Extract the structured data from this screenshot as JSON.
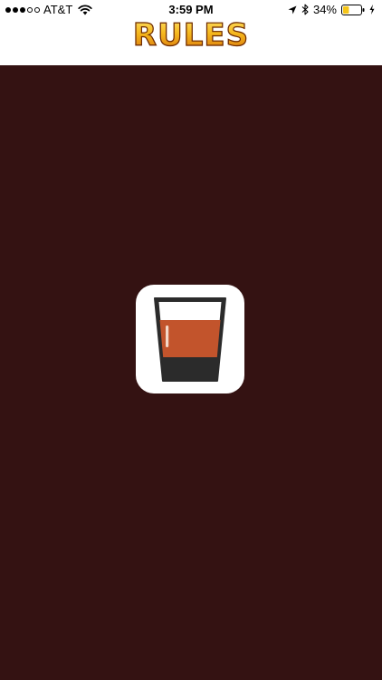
{
  "status_bar": {
    "carrier": "AT&T",
    "time": "3:59 PM",
    "battery_percent_label": "34%",
    "battery_level": 0.34,
    "signal_bars_filled": 3,
    "signal_bars_total": 5,
    "icons": [
      "signal-dots",
      "wifi-icon",
      "location-arrow-icon",
      "bluetooth-icon",
      "battery-icon",
      "charging-bolt-icon"
    ]
  },
  "header": {
    "title": "RULES"
  },
  "main": {
    "background": "#341212",
    "logo_icon": "whiskey-glass-icon"
  },
  "colors": {
    "title_gold": "#f5b71c",
    "title_outline": "#6b2a06",
    "battery_fill": "#f5c518",
    "drink": "#c2542c",
    "glass_dark": "#2b2b2b"
  }
}
